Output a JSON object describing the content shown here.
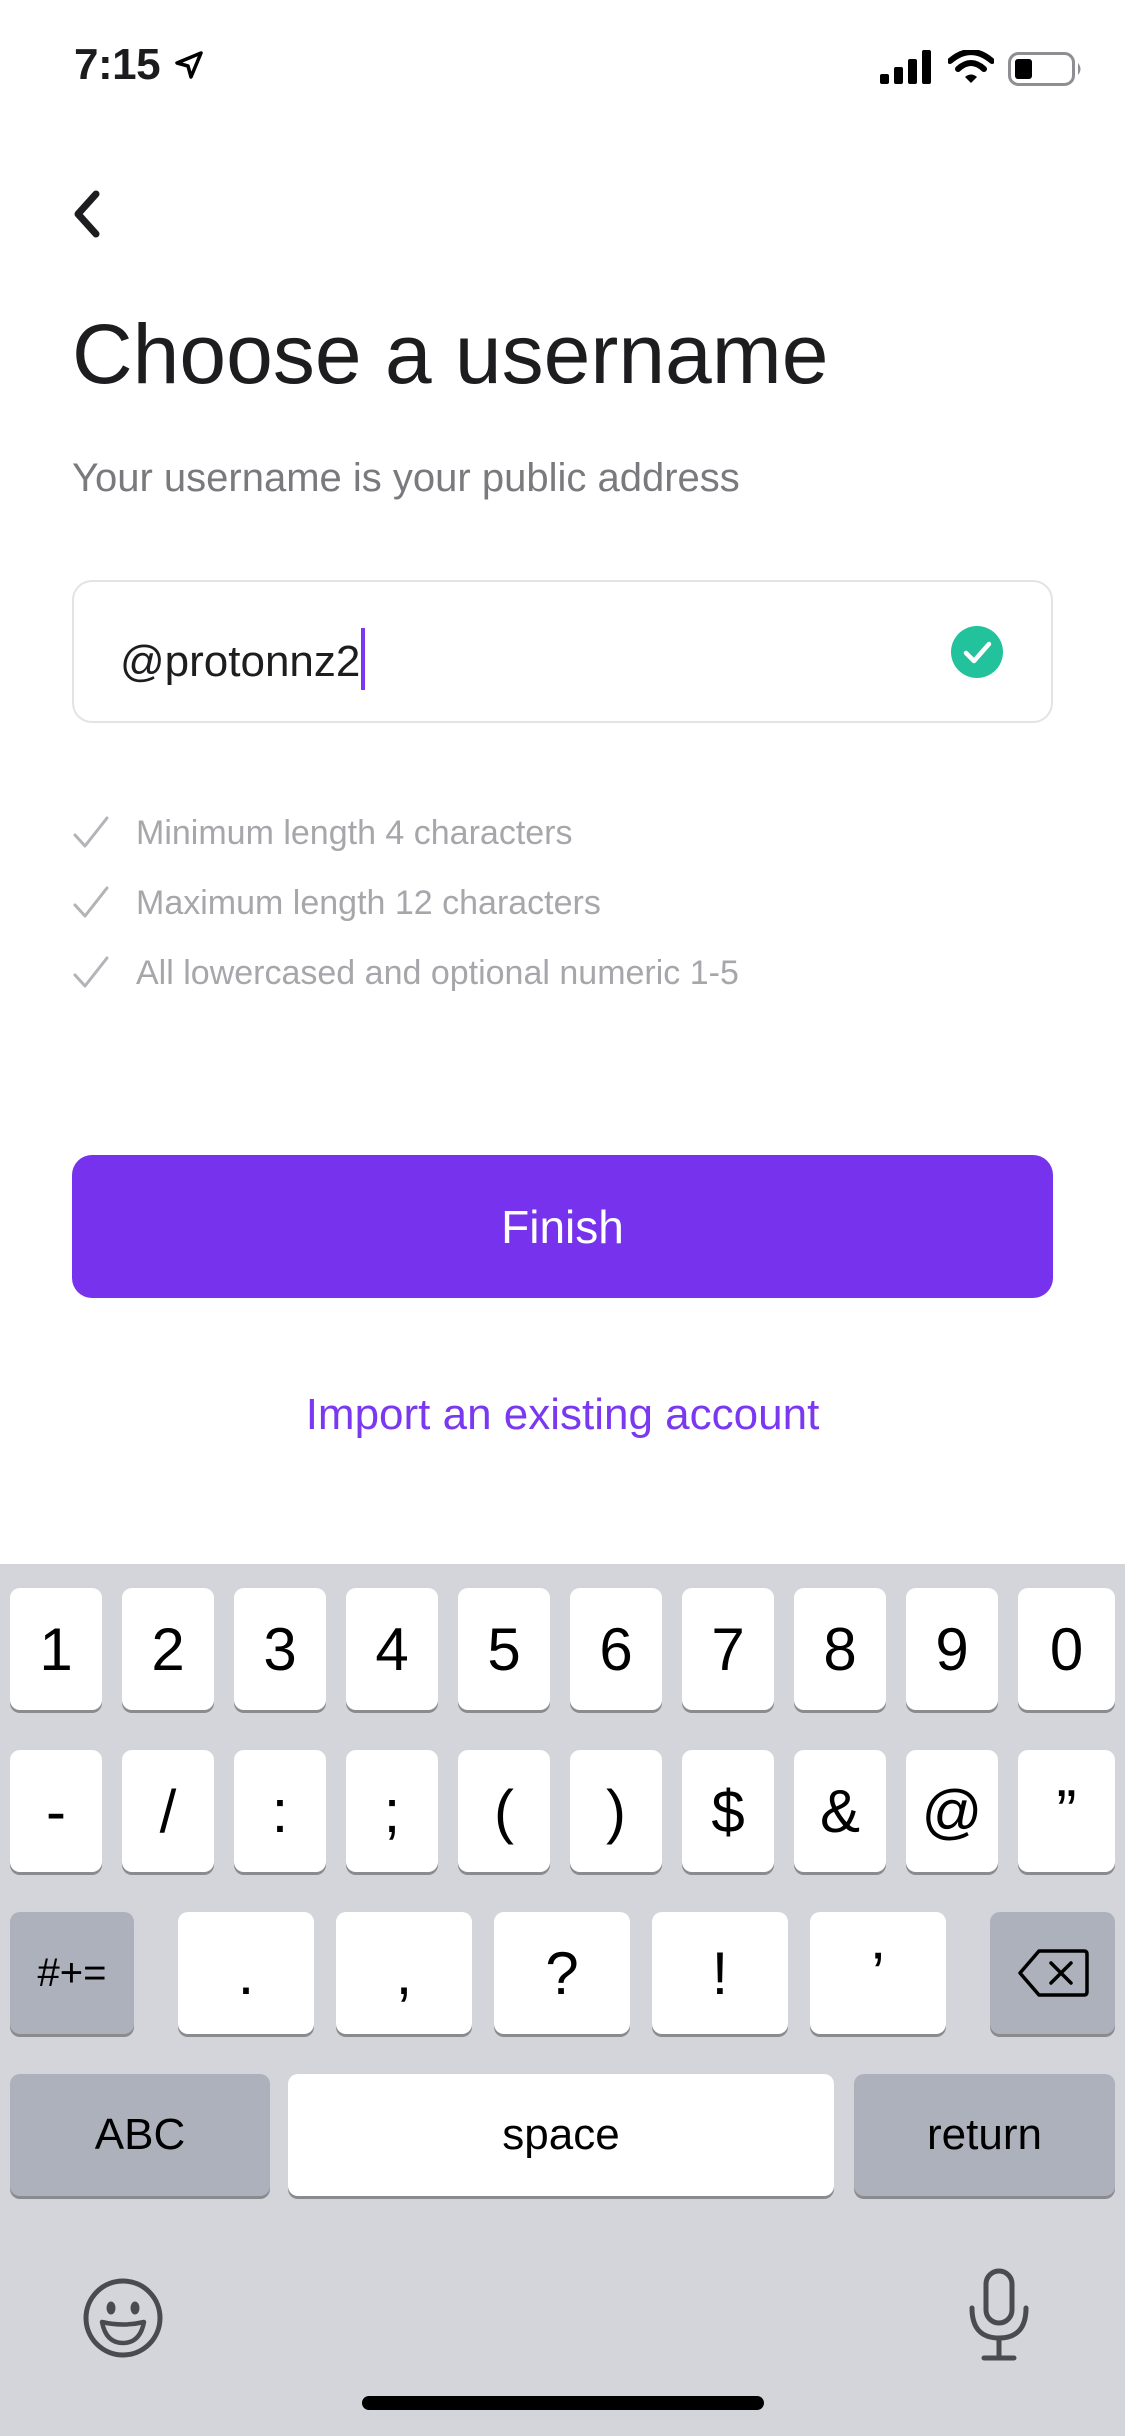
{
  "status_bar": {
    "time": "7:15"
  },
  "header": {
    "back_icon": "chevron-left-icon",
    "title": "Choose a username",
    "subtitle": "Your username is your public address"
  },
  "username_input": {
    "value": "@protonnz2",
    "valid": true,
    "accent_color": "#7a38f0",
    "valid_color": "#22c39c"
  },
  "rules": [
    {
      "label": "Minimum length 4 characters",
      "met": true
    },
    {
      "label": "Maximum length 12 characters",
      "met": true
    },
    {
      "label": "All lowercased and optional numeric 1-5",
      "met": true
    }
  ],
  "finish_button": {
    "label": "Finish",
    "color": "#7632ec"
  },
  "import_link": {
    "label": "Import an existing account"
  },
  "keyboard": {
    "row1": [
      "1",
      "2",
      "3",
      "4",
      "5",
      "6",
      "7",
      "8",
      "9",
      "0"
    ],
    "row2": [
      "-",
      "/",
      ":",
      ";",
      "(",
      ")",
      "$",
      "&",
      "@",
      "”"
    ],
    "row3_mode": "#+=",
    "row3": [
      ".",
      ",",
      "?",
      "!",
      "’"
    ],
    "abc": "ABC",
    "space": "space",
    "return": "return"
  }
}
